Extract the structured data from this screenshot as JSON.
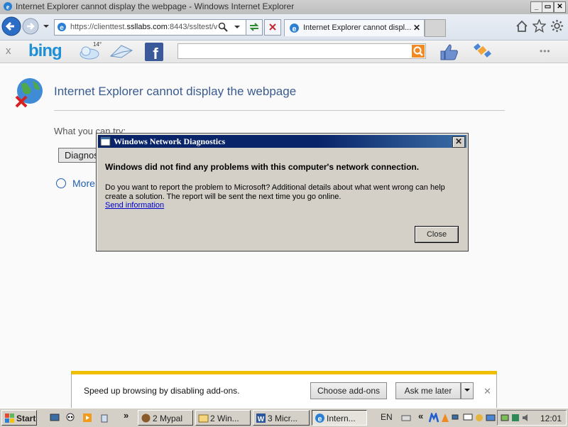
{
  "window": {
    "title": "Internet Explorer cannot display the webpage - Windows Internet Explorer",
    "buttons": [
      "_",
      "▭",
      "✕"
    ]
  },
  "navbar": {
    "address_prefix": "https://clienttest.",
    "address_domain": "ssllabs.com",
    "address_suffix": ":8443/ssltest/v",
    "search_icon": "magnifier-icon",
    "tab_label": "Internet Explorer cannot displ...",
    "tab_close": "✕"
  },
  "bingbar": {
    "close": "x",
    "logo": "bing",
    "weather_temp": "14°",
    "search_value": "",
    "more": "•••"
  },
  "page": {
    "title": "Internet Explorer cannot display the webpage",
    "what_you_can_try": "What you can try:",
    "diagnose_button": "Diagnose Connection Problems",
    "more_info": "More information"
  },
  "dialog": {
    "title": "Windows Network Diagnostics",
    "heading": "Windows did not find any problems with this computer's network connection.",
    "body": "Do you want to report the problem to Microsoft? Additional details about what went wrong can help create a solution. The report will be sent the next time you go online.",
    "link": "Send information",
    "close_button": "Close"
  },
  "notification": {
    "message": "Speed up browsing by disabling add-ons.",
    "choose_button": "Choose add-ons",
    "ask_button": "Ask me later",
    "close": "✕"
  },
  "taskbar": {
    "start": "Start",
    "items": [
      "2 Mypal",
      "2 Win...",
      "3 Micr...",
      "Intern..."
    ],
    "chevron": "»",
    "language": "EN",
    "clock": "12:01"
  },
  "colors": {
    "dialog_title": "#0a246a",
    "link": "#0000cc",
    "page_title": "#3a5b8f",
    "notify_stripe": "#f0c000",
    "bing_blue": "#1f8fd6"
  }
}
